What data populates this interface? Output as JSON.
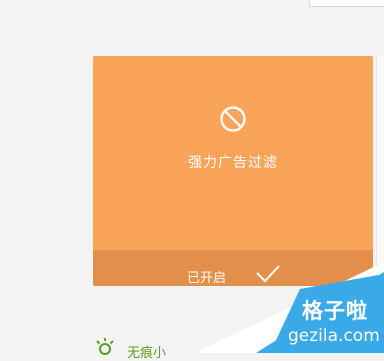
{
  "card": {
    "icon": "ban-icon",
    "title": "强力广告过滤",
    "status_label": "已开启",
    "status_icon": "check-icon",
    "background": "#f9a458",
    "footer_background": "#e38f4c"
  },
  "below_item": {
    "icon": "lightbulb-icon",
    "text": "无痕小",
    "color": "#5a9f1f"
  },
  "watermark": {
    "name": "格子啦",
    "url": "gezila.com",
    "color": "#3aa9e8"
  }
}
